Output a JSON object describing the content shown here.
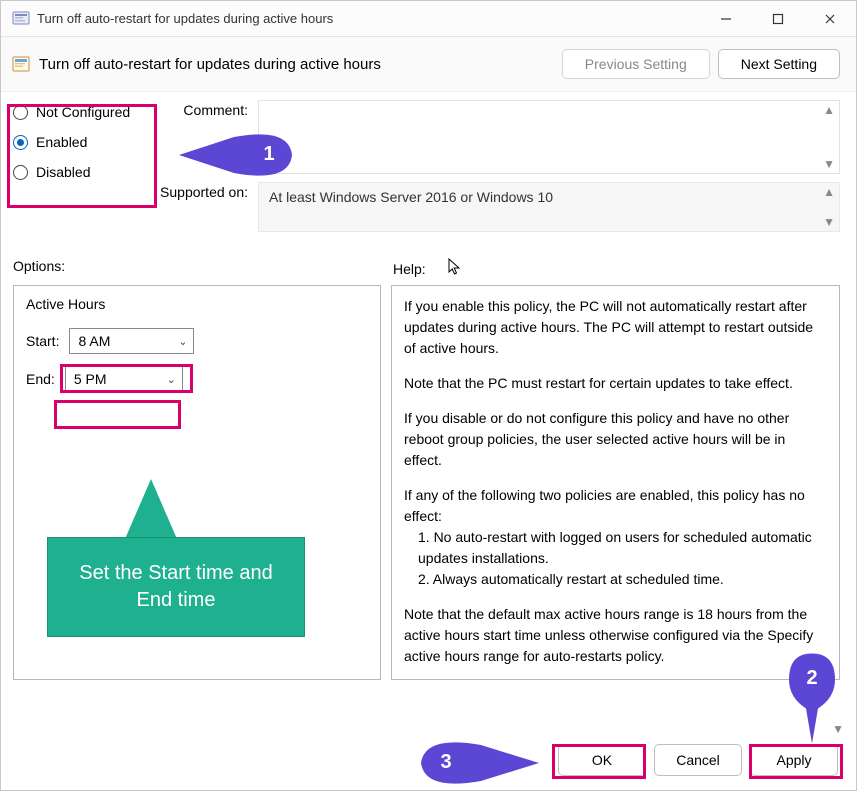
{
  "titlebar": {
    "title": "Turn off auto-restart for updates during active hours"
  },
  "header": {
    "title": "Turn off auto-restart for updates during active hours",
    "prev_btn": "Previous Setting",
    "next_btn": "Next Setting"
  },
  "state_radios": {
    "not_configured": "Not Configured",
    "enabled": "Enabled",
    "disabled": "Disabled",
    "selected": "enabled"
  },
  "fields": {
    "comment_label": "Comment:",
    "comment_value": "",
    "supported_label": "Supported on:",
    "supported_value": "At least Windows Server 2016 or Windows 10"
  },
  "panels": {
    "options_label": "Options:",
    "help_label": "Help:"
  },
  "options": {
    "title": "Active Hours",
    "start_label": "Start:",
    "start_value": "8 AM",
    "end_label": "End:",
    "end_value": "5 PM"
  },
  "help": {
    "p1": "If you enable this policy, the PC will not automatically restart after updates during active hours. The PC will attempt to restart outside of active hours.",
    "p2": "Note that the PC must restart for certain updates to take effect.",
    "p3": "If you disable or do not configure this policy and have no other reboot group policies, the user selected active hours will be in effect.",
    "p4": "If any of the following two policies are enabled, this policy has no effect:",
    "p4a": "1. No auto-restart with logged on users for scheduled automatic updates installations.",
    "p4b": "2. Always automatically restart at scheduled time.",
    "p5": "Note that the default max active hours range is 18 hours from the active hours start time unless otherwise configured via the Specify active hours range for auto-restarts policy."
  },
  "buttons": {
    "ok": "OK",
    "cancel": "Cancel",
    "apply": "Apply"
  },
  "annotations": {
    "num1": "1",
    "num2": "2",
    "num3": "3",
    "tip": "Set the Start time and End time"
  }
}
